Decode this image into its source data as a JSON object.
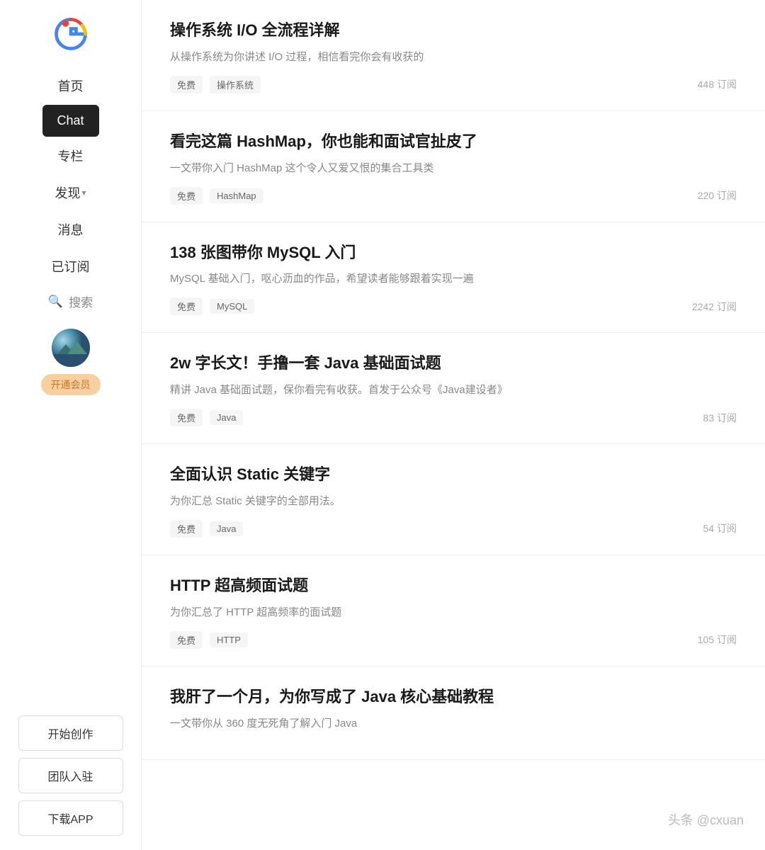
{
  "sidebar": {
    "nav": [
      {
        "id": "home",
        "label": "首页",
        "active": false
      },
      {
        "id": "chat",
        "label": "Chat",
        "active": true
      },
      {
        "id": "column",
        "label": "专栏",
        "active": false
      },
      {
        "id": "discover",
        "label": "发现",
        "active": false,
        "hasDropdown": true
      },
      {
        "id": "messages",
        "label": "消息",
        "active": false
      },
      {
        "id": "subscribed",
        "label": "已订阅",
        "active": false
      }
    ],
    "search_label": "搜索",
    "vip_label": "开通会员",
    "buttons": [
      {
        "id": "create",
        "label": "开始创作"
      },
      {
        "id": "team",
        "label": "团队入驻"
      },
      {
        "id": "app",
        "label": "下载APP"
      }
    ]
  },
  "articles": [
    {
      "title": "操作系统 I/O 全流程详解",
      "desc": "从操作系统为你讲述 I/O 过程，相信看完你会有收获的",
      "tags": [
        "免费",
        "操作系统"
      ],
      "subscribe": "448 订阅"
    },
    {
      "title": "看完这篇 HashMap，你也能和面试官扯皮了",
      "desc": "一文带你入门 HashMap 这个令人又爱又恨的集合工具类",
      "tags": [
        "免费",
        "HashMap"
      ],
      "subscribe": "220 订阅"
    },
    {
      "title": "138 张图带你 MySQL 入门",
      "desc": "MySQL 基础入门，呕心沥血的作品，希望读者能够跟着实现一遍",
      "tags": [
        "免费",
        "MySQL"
      ],
      "subscribe": "2242 订阅"
    },
    {
      "title": "2w 字长文！手撸一套 Java 基础面试题",
      "desc": "精讲 Java 基础面试题，保你看完有收获。首发于公众号《Java建设者》",
      "tags": [
        "免费",
        "Java"
      ],
      "subscribe": "83 订阅"
    },
    {
      "title": "全面认识 Static 关键字",
      "desc": "为你汇总 Static 关键字的全部用法。",
      "tags": [
        "免费",
        "Java"
      ],
      "subscribe": "54 订阅"
    },
    {
      "title": "HTTP 超高频面试题",
      "desc": "为你汇总了 HTTP 超高频率的面试题",
      "tags": [
        "免费",
        "HTTP"
      ],
      "subscribe": "105 订阅"
    },
    {
      "title": "我肝了一个月，为你写成了 Java 核心基础教程",
      "desc": "一文带你从 360 度无死角了解入门 Java",
      "tags": [],
      "subscribe": ""
    }
  ],
  "watermark": "头条 @cxuan"
}
